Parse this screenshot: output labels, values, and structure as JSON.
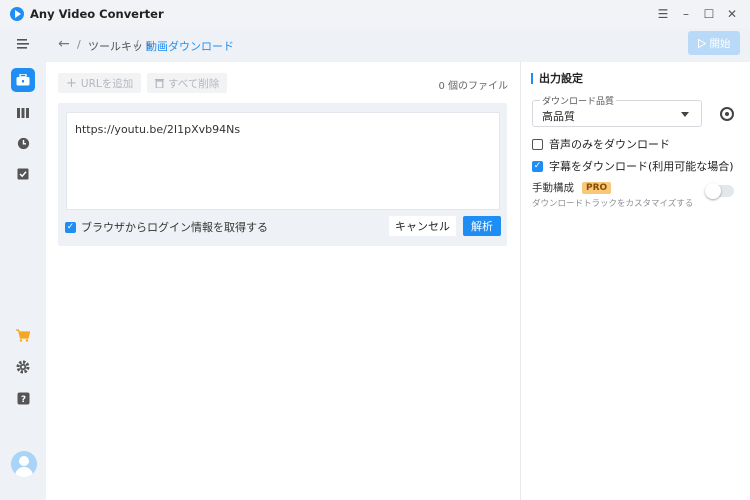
{
  "app": {
    "title": "Any Video Converter"
  },
  "window_controls": {
    "menu": "☰",
    "minimize": "–",
    "maximize": "☐",
    "close": "✕"
  },
  "sidebar": {
    "items": [
      {
        "icon": "collapse-menu-icon"
      },
      {
        "icon": "toolbox-icon",
        "active": true
      },
      {
        "icon": "library-icon"
      },
      {
        "icon": "history-icon"
      },
      {
        "icon": "task-check-icon"
      },
      {
        "icon": "cart-icon"
      },
      {
        "icon": "settings-icon"
      },
      {
        "icon": "help-icon"
      },
      {
        "icon": "user-avatar"
      }
    ]
  },
  "header": {
    "separator": "/",
    "crumb_toolkit": "ツールキット",
    "crumb_current": "動画ダウンロード",
    "start_label": "開始"
  },
  "toolbar": {
    "add_url": "URLを追加",
    "delete_all": "すべて削除",
    "file_count": "0 個のファイル"
  },
  "input": {
    "url_value": "https://youtu.be/2I1pXvb94Ns",
    "login_label": "ブラウザからログイン情報を取得する",
    "login_checked": true,
    "cancel": "キャンセル",
    "parse": "解析"
  },
  "output": {
    "title": "出力設定",
    "quality_label": "ダウンロード品質",
    "quality_value": "高品質",
    "audio_only": "音声のみをダウンロード",
    "audio_only_checked": false,
    "subtitles": "字幕をダウンロード(利用可能な場合)",
    "subtitles_checked": true,
    "manual_config": "手動構成",
    "pro_badge": "PRO",
    "manual_hint": "ダウンロードトラックをカスタマイズする",
    "manual_enabled": false
  },
  "colors": {
    "accent": "#1e8ef5",
    "pro": "#f7c87a",
    "disabled_button": "#b8d9f7"
  }
}
